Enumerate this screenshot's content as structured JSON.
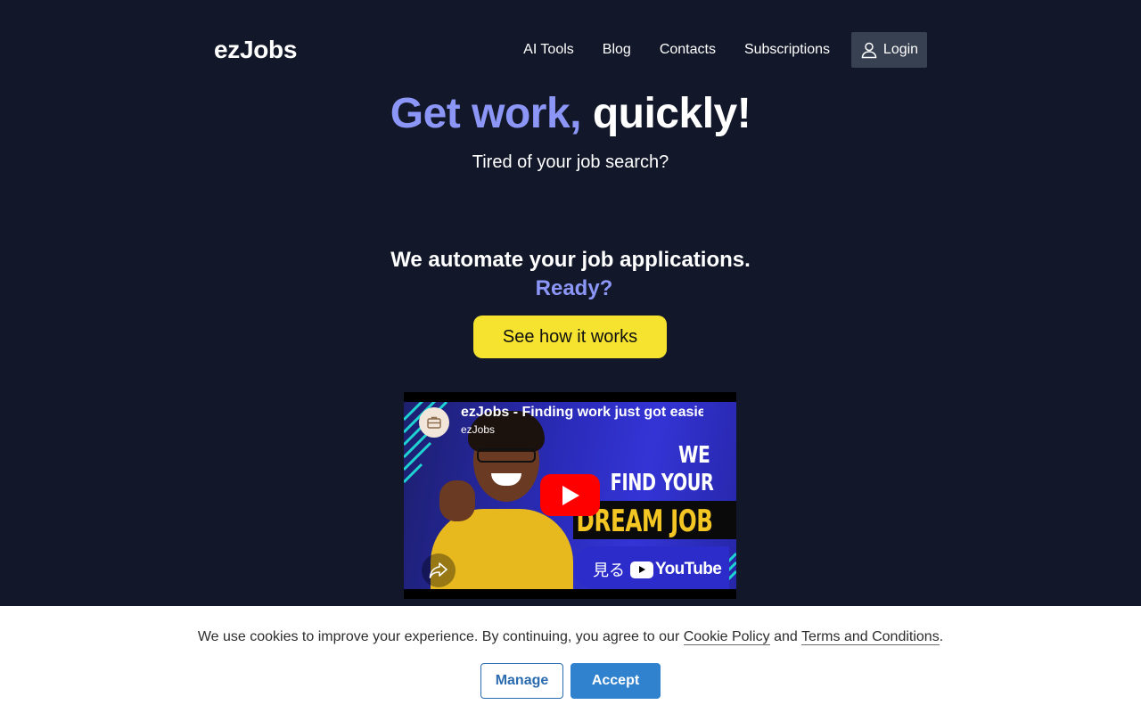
{
  "header": {
    "logo": "ezJobs",
    "nav": [
      "AI Tools",
      "Blog",
      "Contacts",
      "Subscriptions"
    ],
    "login_label": "Login",
    "login_icon": "user-icon"
  },
  "hero": {
    "title_accent": "Get work,",
    "title_rest": "quickly!",
    "subtitle": "Tired of your job search?",
    "automate_line": "We automate your job applications.",
    "ready_line": "Ready?",
    "cta_label": "See how it works"
  },
  "video": {
    "title": "ezJobs - Finding work just got easier",
    "channel": "ezJobs",
    "thumb_line1": "WE",
    "thumb_line2": "FIND YOUR",
    "thumb_line3": "DREAM JOB",
    "watch_on": "見る",
    "youtube_word": "YouTube",
    "play_icon": "play-icon",
    "share_icon": "share-icon"
  },
  "cookie": {
    "text_before": "We use cookies to improve your experience. By continuing, you agree to our ",
    "cookie_policy": "Cookie Policy",
    "text_and": " and ",
    "terms": "Terms and Conditions",
    "text_end": ".",
    "manage_label": "Manage",
    "accept_label": "Accept"
  },
  "colors": {
    "background": "#121829",
    "accent": "#8c96f7",
    "cta": "#f5e32f",
    "login_bg": "#374151",
    "accept_bg": "#3182ce"
  }
}
